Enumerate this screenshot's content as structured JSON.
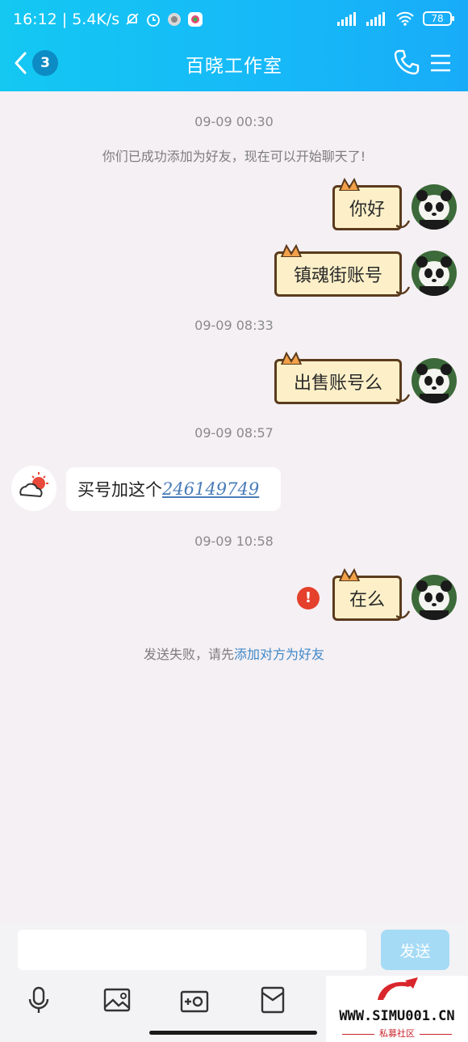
{
  "status_bar": {
    "time": "16:12",
    "speed": "| 5.4K/s",
    "battery": "78"
  },
  "nav": {
    "unread_count": "3",
    "title": "百晓工作室"
  },
  "chat": {
    "timestamps": [
      "09-09 00:30",
      "09-09 08:33",
      "09-09 08:57",
      "09-09 10:58"
    ],
    "system_friend": "你们已成功添加为好友，现在可以开始聊天了!",
    "messages": [
      {
        "side": "right",
        "text": "你好"
      },
      {
        "side": "right",
        "text": "镇魂街账号"
      },
      {
        "side": "right",
        "text": "出售账号么"
      },
      {
        "side": "left",
        "text": "买号加这个",
        "number": "246149749"
      },
      {
        "side": "right",
        "text": "在么",
        "status": "failed"
      }
    ],
    "fail_notice": {
      "text": "发送失败，请先",
      "link": "添加对方为好友"
    }
  },
  "composer": {
    "send_label": "发送"
  },
  "toolbar": {
    "icons": [
      "microphone-icon",
      "image-icon",
      "camera-icon",
      "red-packet-icon"
    ]
  },
  "watermark": {
    "url": "WWW.SIMU001.CN",
    "subtitle": "私募社区"
  },
  "colors": {
    "header": "#16b8f8",
    "bubble_cat": "#fdf0c8",
    "error": "#e5402c",
    "link": "#3e88c8"
  }
}
